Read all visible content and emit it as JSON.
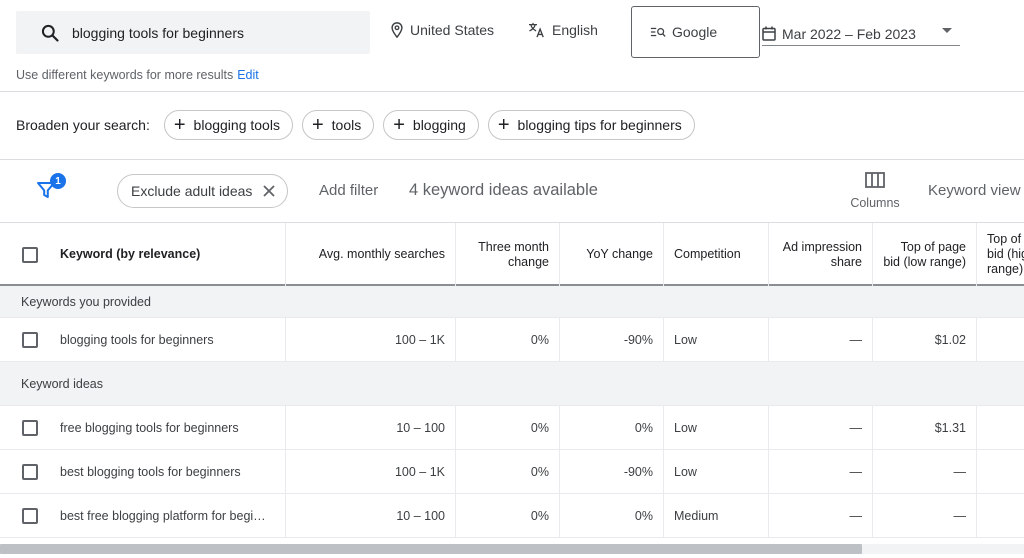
{
  "search": {
    "query": "blogging tools for beginners"
  },
  "location": "United States",
  "language": "English",
  "network": "Google",
  "date_range": "Mar 2022 – Feb 2023",
  "hint": {
    "text": "Use different keywords for more results",
    "edit": "Edit"
  },
  "broaden": {
    "label": "Broaden your search:",
    "chips": [
      "blogging tools",
      "tools",
      "blogging",
      "blogging tips for beginners"
    ]
  },
  "filters": {
    "badge": "1",
    "exclude_chip": "Exclude adult ideas",
    "add_filter": "Add filter",
    "count_text": "4 keyword ideas available",
    "columns_label": "Columns",
    "keyword_view": "Keyword view"
  },
  "table": {
    "headers": {
      "keyword": "Keyword (by relevance)",
      "avg": "Avg. monthly searches",
      "three_month": "Three month change",
      "yoy": "YoY change",
      "competition": "Competition",
      "ad_share": "Ad impression share",
      "top_low": "Top of page bid (low range)",
      "top_high": "Top of page bid (high range)"
    },
    "group_provided": "Keywords you provided",
    "group_ideas": "Keyword ideas",
    "rows": [
      {
        "keyword": "blogging tools for beginners",
        "avg": "100 – 1K",
        "three_month": "0%",
        "yoy": "-90%",
        "competition": "Low",
        "ad_share": "—",
        "top_low": "$1.02"
      },
      {
        "keyword": "free blogging tools for beginners",
        "avg": "10 – 100",
        "three_month": "0%",
        "yoy": "0%",
        "competition": "Low",
        "ad_share": "—",
        "top_low": "$1.31"
      },
      {
        "keyword": "best blogging tools for beginners",
        "avg": "100 – 1K",
        "three_month": "0%",
        "yoy": "-90%",
        "competition": "Low",
        "ad_share": "—",
        "top_low": "—"
      },
      {
        "keyword": "best free blogging platform for begi…",
        "avg": "10 – 100",
        "three_month": "0%",
        "yoy": "0%",
        "competition": "Medium",
        "ad_share": "—",
        "top_low": "—"
      }
    ]
  }
}
